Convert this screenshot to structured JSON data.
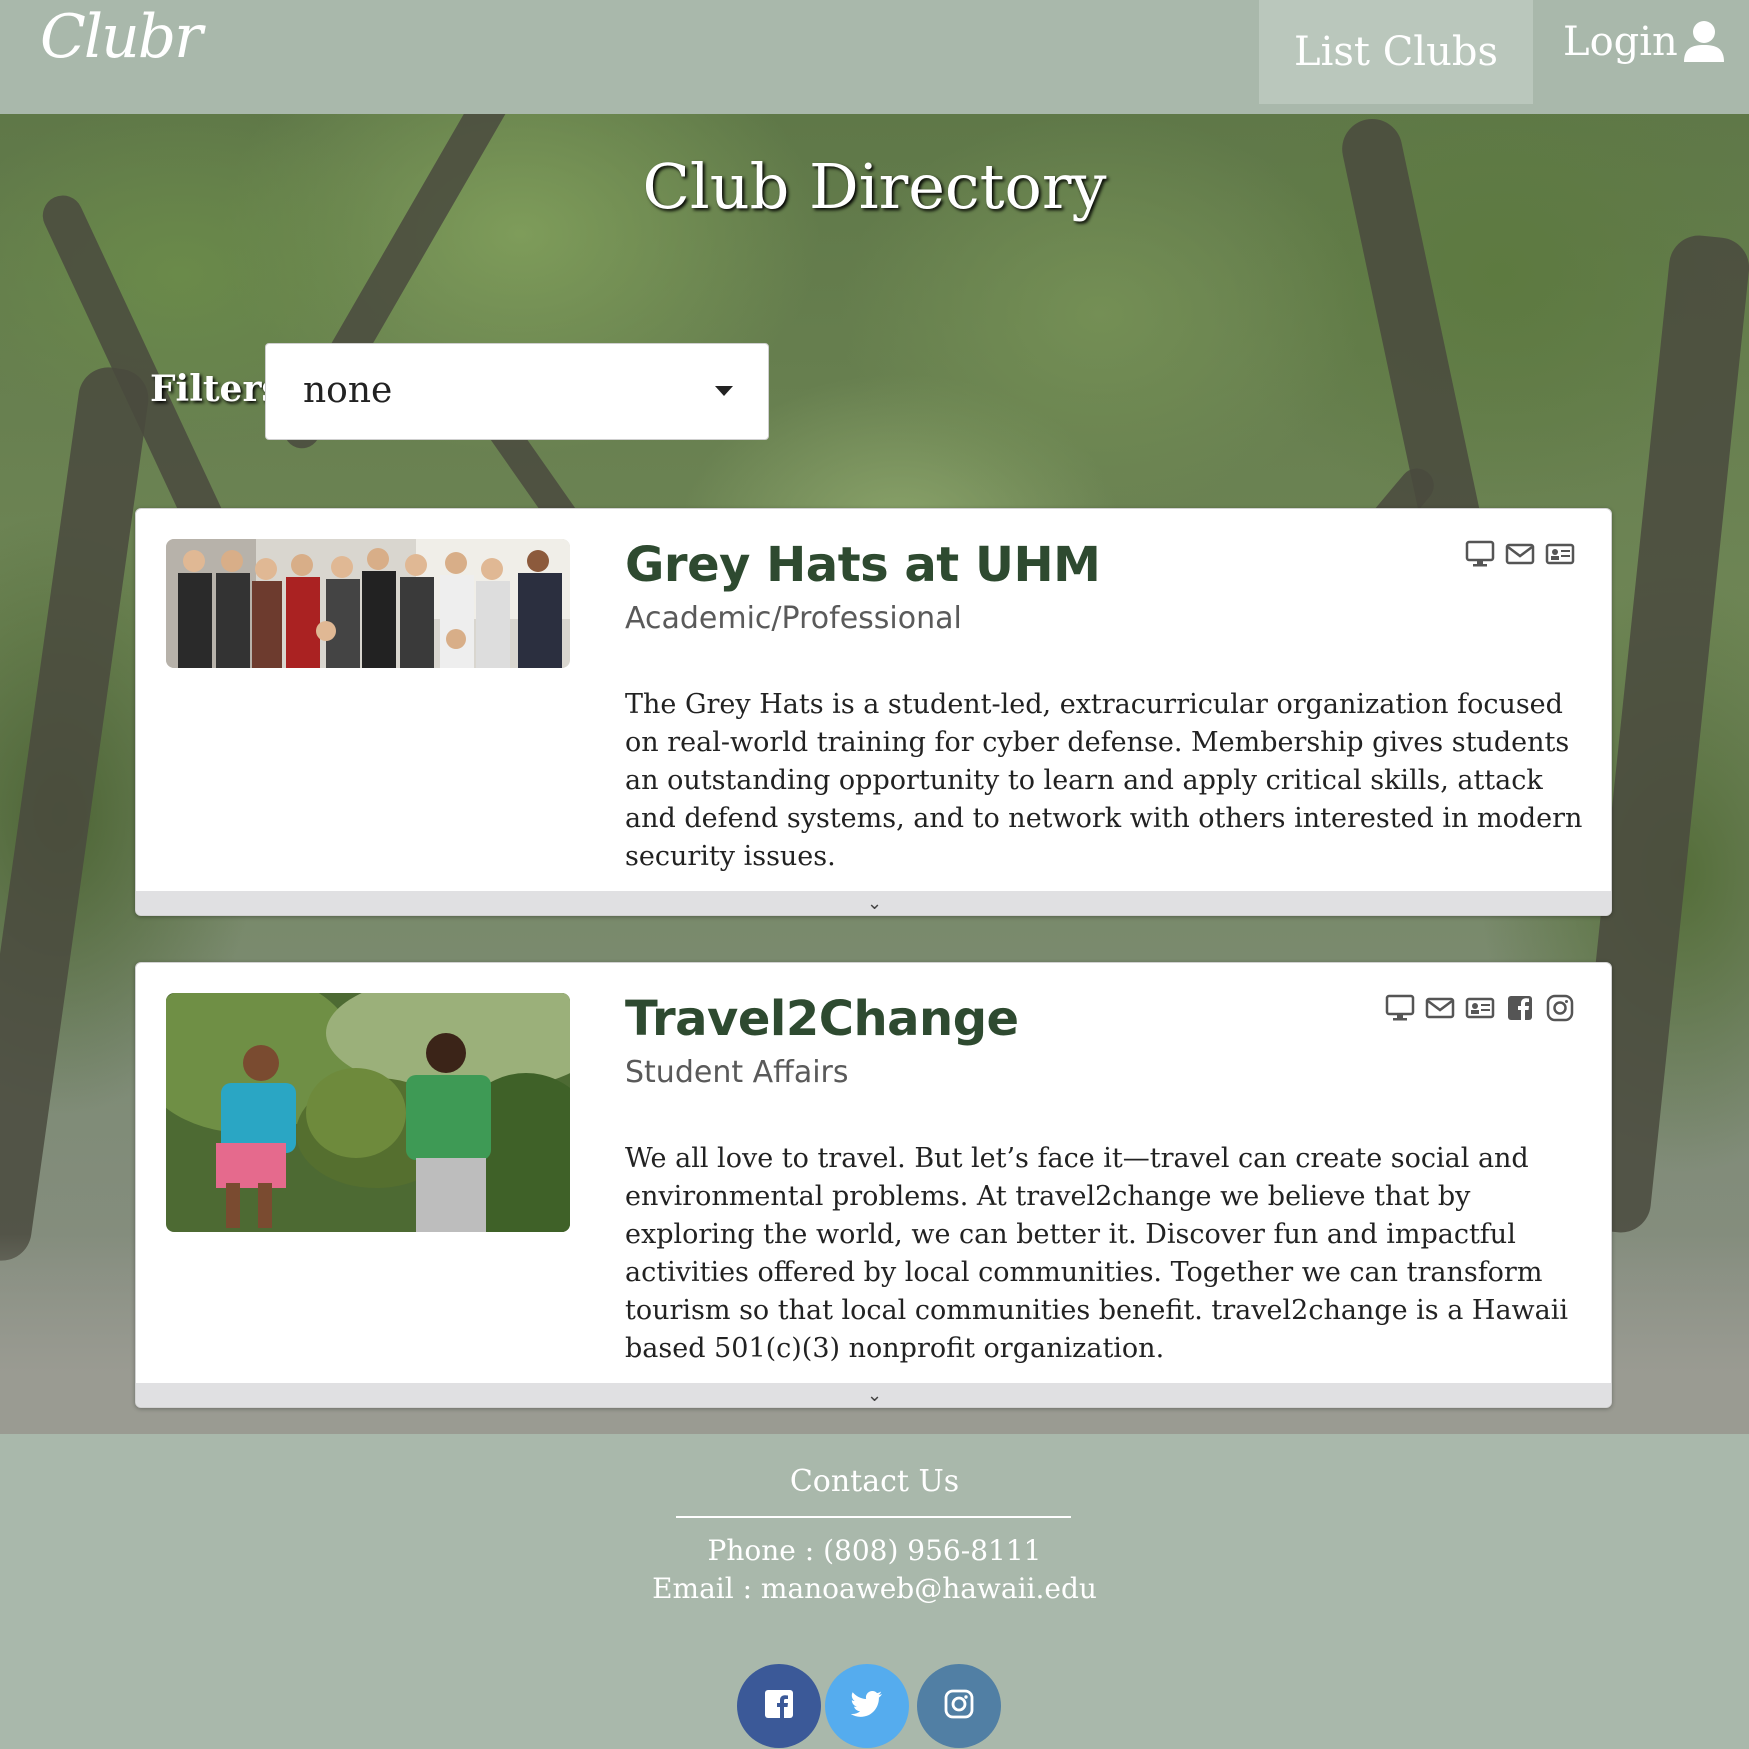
{
  "navbar": {
    "logo": "Clubr",
    "list_clubs": "List Clubs",
    "login": "Login",
    "login_icon": "user-icon"
  },
  "page": {
    "title": "Club Directory"
  },
  "filters": {
    "label": "Filters",
    "selected": "none"
  },
  "clubs": [
    {
      "name": "Grey Hats at UHM",
      "category": "Academic/Professional",
      "description": "The Grey Hats is a student-led, extracurricular organization focused on real-world training for cyber defense. Membership gives students an outstanding opportunity to learn and apply critical skills, attack and defend systems, and to network with others interested in modern security issues.",
      "icons": [
        "website-icon",
        "email-icon",
        "contact-card-icon"
      ],
      "expand_icon": "chevron-down-icon"
    },
    {
      "name": "Travel2Change",
      "category": "Student Affairs",
      "description": "We all love to travel. But let’s face it—travel can create social and environmental problems. At travel2change we believe that by exploring the world, we can better it. Discover fun and impactful activities offered by local communities. Together we can transform tourism so that local communities benefit. travel2change is a Hawaii based 501(c)(3) nonprofit organization.",
      "icons": [
        "website-icon",
        "email-icon",
        "contact-card-icon",
        "facebook-icon",
        "instagram-icon"
      ],
      "expand_icon": "chevron-down-icon"
    }
  ],
  "footer": {
    "title": "Contact Us",
    "phone": "Phone : (808) 956-8111",
    "email": "Email : manoaweb@hawaii.edu",
    "social": [
      {
        "icon": "facebook-icon",
        "color": "#3b5998"
      },
      {
        "icon": "twitter-icon",
        "color": "#55acee"
      },
      {
        "icon": "instagram-icon",
        "color": "#517fa4"
      }
    ]
  },
  "colors": {
    "nav_bg": "#a9b8ab",
    "title_green": "#2e4a30"
  }
}
